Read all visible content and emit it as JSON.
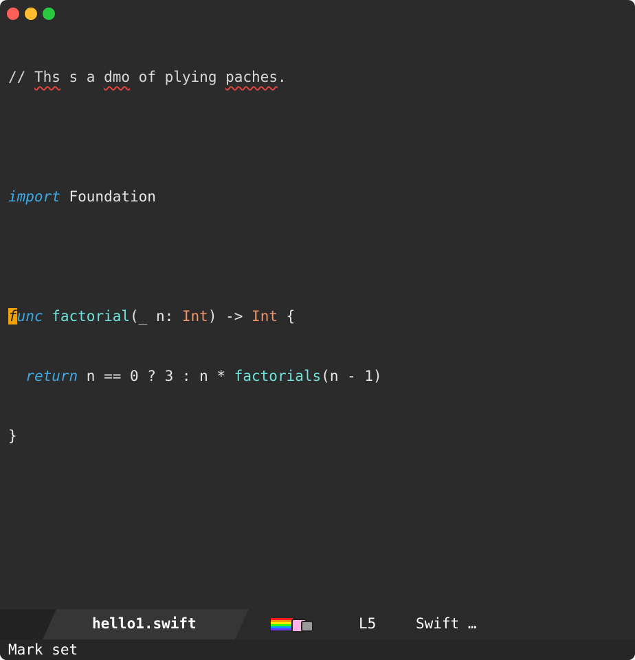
{
  "window": {
    "controls": [
      "close",
      "minimize",
      "zoom"
    ]
  },
  "editor": {
    "comment_prefix": "// ",
    "comment_words": [
      {
        "text": "Ths",
        "misspelled": true
      },
      {
        "text": " s a ",
        "misspelled": false
      },
      {
        "text": "dmo",
        "misspelled": true
      },
      {
        "text": " of plying ",
        "misspelled": false
      },
      {
        "text": "paches",
        "misspelled": true
      },
      {
        "text": ".",
        "misspelled": false
      }
    ],
    "line3_keyword": "import",
    "line3_module": " Foundation",
    "line5_cursor_char": "f",
    "line5_keyword_rest": "unc",
    "line5_fn": " factorial",
    "line5_a": "(_ n: ",
    "line5_type1": "Int",
    "line5_b": ") -> ",
    "line5_type2": "Int",
    "line5_c": " {",
    "line6_indent": "  ",
    "line6_keyword": "return",
    "line6_a": " n == 0 ? 3 : n * ",
    "line6_fn": "factorials",
    "line6_b": "(n - 1)",
    "line7": "}"
  },
  "modeline": {
    "buffer_name": "hello1.swift",
    "line": "L5",
    "mode": "Swift …"
  },
  "echo_area": {
    "message": "Mark set"
  },
  "colors": {
    "background": "#2b2b2b",
    "keyword": "#3fa9e6",
    "function": "#6ee3d9",
    "type": "#f0946a",
    "cursor": "#f0a20a",
    "spell_error": "#e0443e"
  }
}
